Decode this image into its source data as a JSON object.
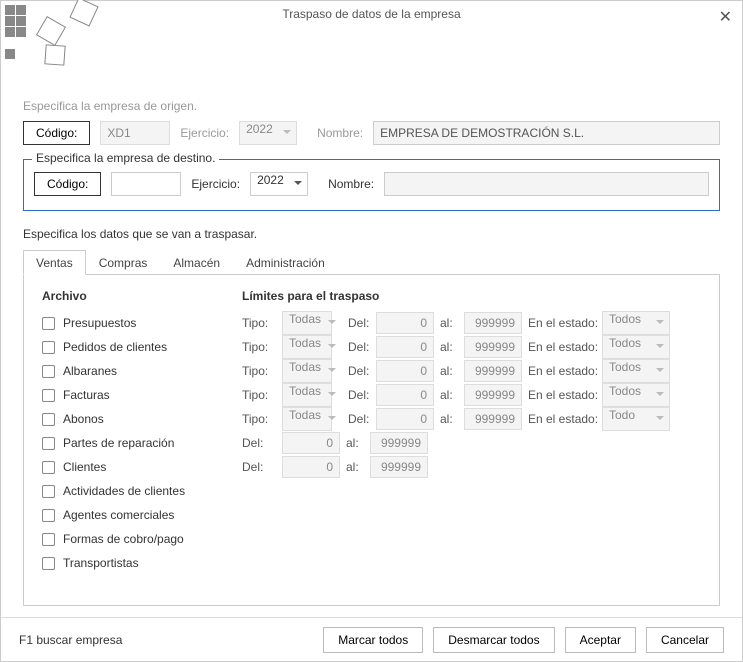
{
  "window": {
    "title": "Traspaso de datos de la empresa"
  },
  "origin": {
    "heading": "Especifica la empresa de origen.",
    "code_button": "Código:",
    "code_value": "XD1",
    "ejercicio_label": "Ejercicio:",
    "ejercicio_value": "2022",
    "nombre_label": "Nombre:",
    "nombre_value": "EMPRESA DE DEMOSTRACIÓN S.L."
  },
  "dest": {
    "legend": "Especifica la empresa de destino.",
    "code_button": "Código:",
    "code_value": "",
    "ejercicio_label": "Ejercicio:",
    "ejercicio_value": "2022",
    "nombre_label": "Nombre:",
    "nombre_value": ""
  },
  "data_heading": "Especifica los datos que se van a traspasar.",
  "tabs": {
    "ventas": "Ventas",
    "compras": "Compras",
    "almacen": "Almacén",
    "administracion": "Administración"
  },
  "panel": {
    "archivo_header": "Archivo",
    "limites_header": "Límites para el traspaso",
    "tipo_label": "Tipo:",
    "tipo_value": "Todas",
    "del_label": "Del:",
    "al_label": "al:",
    "del_value": "0",
    "al_value": "999999",
    "estado_label": "En el estado:",
    "estado_todos": "Todos",
    "estado_todo": "Todo",
    "items": [
      {
        "label": "Presupuestos",
        "full": true,
        "estado": "Todos"
      },
      {
        "label": "Pedidos de clientes",
        "full": true,
        "estado": "Todos"
      },
      {
        "label": "Albaranes",
        "full": true,
        "estado": "Todos"
      },
      {
        "label": "Facturas",
        "full": true,
        "estado": "Todos"
      },
      {
        "label": "Abonos",
        "full": true,
        "estado": "Todo"
      },
      {
        "label": "Partes de reparación",
        "delal": true
      },
      {
        "label": "Clientes",
        "delal": true
      },
      {
        "label": "Actividades de clientes"
      },
      {
        "label": "Agentes comerciales"
      },
      {
        "label": "Formas de cobro/pago"
      },
      {
        "label": "Transportistas"
      }
    ]
  },
  "footer": {
    "f1": "F1 buscar empresa",
    "marcar": "Marcar todos",
    "desmarcar": "Desmarcar todos",
    "aceptar": "Aceptar",
    "cancelar": "Cancelar"
  }
}
